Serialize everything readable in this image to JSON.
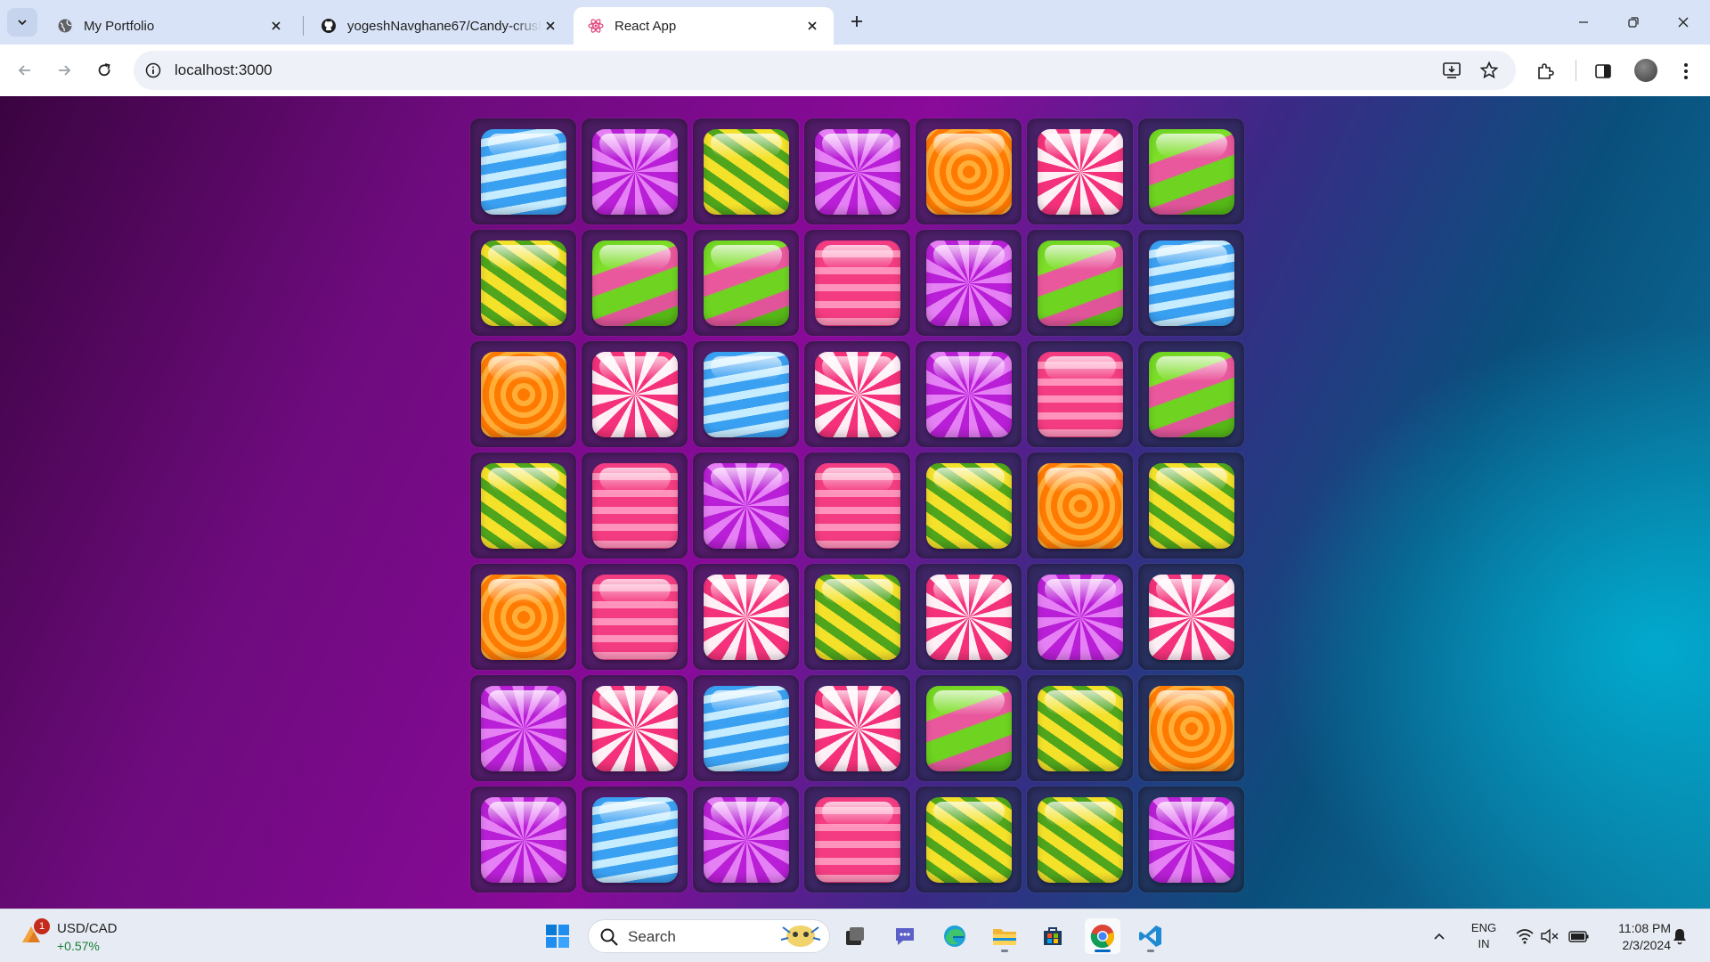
{
  "browser": {
    "tabs": [
      {
        "title": "My Portfolio",
        "icon": "globe-icon"
      },
      {
        "title": "yogeshNavghane67/Candy-crush",
        "icon": "github-icon"
      },
      {
        "title": "React App",
        "icon": "react-icon",
        "active": true
      }
    ],
    "address": {
      "url": "localhost:3000"
    }
  },
  "board": {
    "columns": 7,
    "rows": [
      [
        "blue",
        "purple",
        "yellow",
        "purple",
        "orange",
        "red",
        "green"
      ],
      [
        "yellow",
        "green",
        "green",
        "pink",
        "purple",
        "green",
        "blue"
      ],
      [
        "orange",
        "red",
        "blue",
        "red",
        "purple",
        "pink",
        "green"
      ],
      [
        "yellow",
        "pink",
        "purple",
        "pink",
        "yellow",
        "orange",
        "yellow"
      ],
      [
        "orange",
        "pink",
        "red",
        "yellow",
        "red",
        "purple",
        "red"
      ],
      [
        "purple",
        "red",
        "blue",
        "red",
        "green",
        "yellow",
        "orange"
      ],
      [
        "purple",
        "blue",
        "purple",
        "pink",
        "yellow",
        "yellow",
        "purple"
      ]
    ]
  },
  "taskbar": {
    "widget": {
      "title": "USD/CAD",
      "change": "+0.57%",
      "badge": "1"
    },
    "search_label": "Search",
    "tray": {
      "lang_line1": "ENG",
      "lang_line2": "IN",
      "time": "11:08 PM",
      "date": "2/3/2024"
    }
  },
  "colors": {
    "accent": "#0067c0",
    "positive": "#1a7f37",
    "badge": "#c42b1c"
  }
}
